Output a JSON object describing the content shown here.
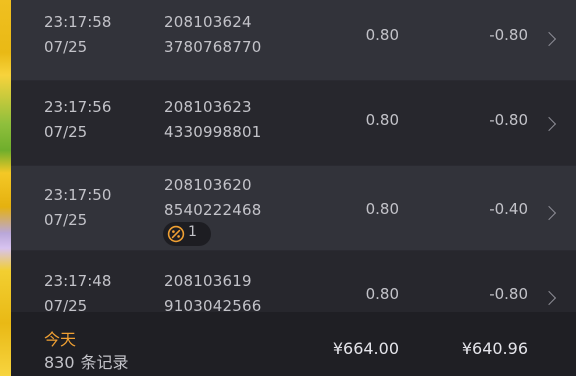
{
  "transactions": [
    {
      "time": "23:17:58",
      "date": "07/25",
      "order_line1": "208103624",
      "order_line2": "3780768770",
      "amount": "0.80",
      "net": "-0.80"
    },
    {
      "time": "23:17:56",
      "date": "07/25",
      "order_line1": "208103623",
      "order_line2": "4330998801",
      "amount": "0.80",
      "net": "-0.80"
    },
    {
      "time": "23:17:50",
      "date": "07/25",
      "order_line1": "208103620",
      "order_line2": "8540222468",
      "amount": "0.80",
      "net": "-0.40",
      "badge_count": "1",
      "badge_icon": "bonus-coin-icon"
    },
    {
      "time": "23:17:48",
      "date": "07/25",
      "order_line1": "208103619",
      "order_line2": "9103042566",
      "amount": "0.80",
      "net": "-0.80"
    }
  ],
  "summary": {
    "period": "今天",
    "record_count": "830",
    "record_unit": "条记录",
    "total_amount": "¥664.00",
    "total_net": "¥640.96"
  },
  "colors": {
    "row_odd": "#32333a",
    "row_even": "#27272d",
    "footer_bg": "#1f1f24",
    "accent": "#f0a033",
    "text": "#c3c3c9"
  }
}
